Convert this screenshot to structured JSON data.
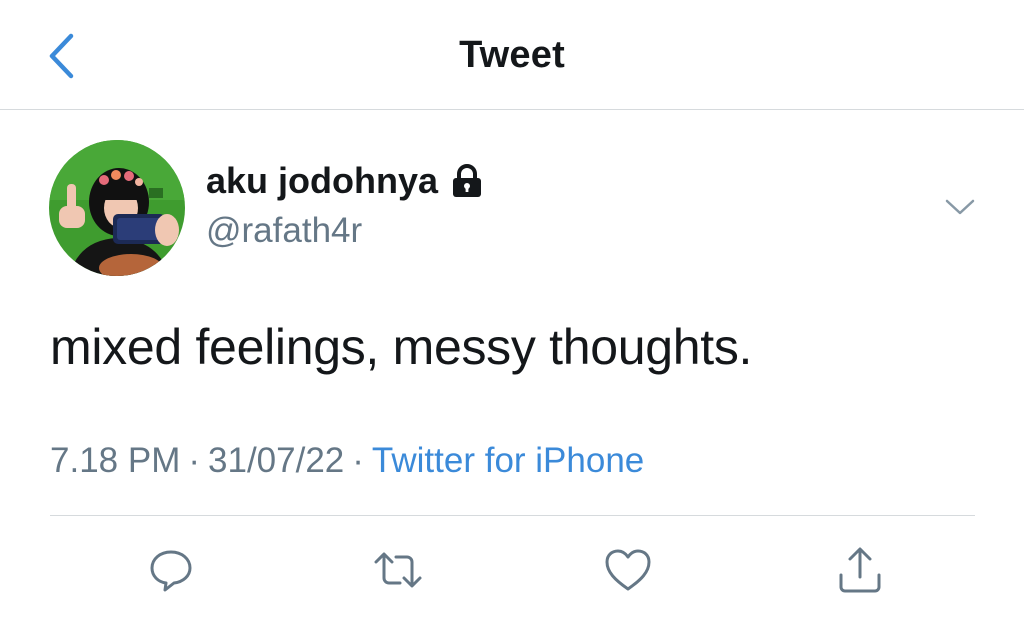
{
  "header": {
    "title": "Tweet",
    "back_icon": "chevron-left-icon"
  },
  "author": {
    "display_name": "aku jodohnya",
    "handle": "@rafath4r",
    "protected_icon": "lock-icon",
    "avatar_background": "#3f9c2f"
  },
  "tweet": {
    "text": "mixed feelings, messy thoughts.",
    "time": "7.18 PM",
    "date": "31/07/22",
    "separator": "·",
    "source": "Twitter for iPhone"
  },
  "actions": [
    {
      "icon": "reply-icon"
    },
    {
      "icon": "retweet-icon"
    },
    {
      "icon": "like-icon"
    },
    {
      "icon": "share-icon"
    }
  ],
  "colors": {
    "accent": "#3b8ad9",
    "text_primary": "#14171a",
    "text_secondary": "#657786",
    "divider": "#d6dadd"
  }
}
